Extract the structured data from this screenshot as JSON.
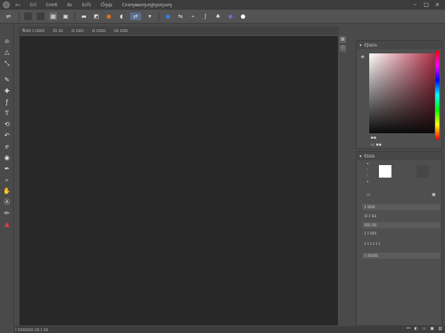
{
  "menubar": {
    "items": [
      "ɪ‹‹",
      "Cr)",
      "Crmlt",
      "Ƨυ",
      "ƧɔΤɪ",
      "Ƈɱɩɭƨ",
      "Cnɑɱɴɴɑɱɩɱɭɱɑɱɩɑɱ"
    ]
  },
  "options": {
    "icons": [
      "move-icon",
      "layer-icon",
      "transform-icon",
      "align-icon",
      "mode-icon",
      "arrange-icon",
      "select-icon",
      "color-icon",
      "swap-icon",
      "link-icon",
      "shape-icon",
      "glyph-icon"
    ]
  },
  "tabs": {
    "items": [
      "Ɓɑɪɪ ɪ ɪɪɪɪɪɪ",
      "Ƨɪ ɪɪɪ",
      "ɪɪ ɪɪɪɪɪ",
      "ɪɪ ɪɪɪɪɪɪ",
      "ɪɪɪ ɪɪɪɪɪ"
    ]
  },
  "color_panel": {
    "title": "Eʃɑɪɪɪɩ"
  },
  "properties_panel": {
    "title": "Eɪɪɪɪɪ",
    "rows": [
      "ɪ ɪɪɪɪɪ",
      "ɪɪ ɪ ɪɪɪ",
      "ɪɪɪɪ ɪɪɪ",
      "ɪ ɪ ɪɪɪɪ",
      "ɪ ɪ ɪ ɪ ɪ ɪ",
      "ɪ ɪɪɪɪɪɪɪ"
    ]
  },
  "status": {
    "text": "Ⅰ ɪɪɪɪɪɪɪɪɪɪ ɪɪɪ ɪ ɪɪɪ"
  }
}
